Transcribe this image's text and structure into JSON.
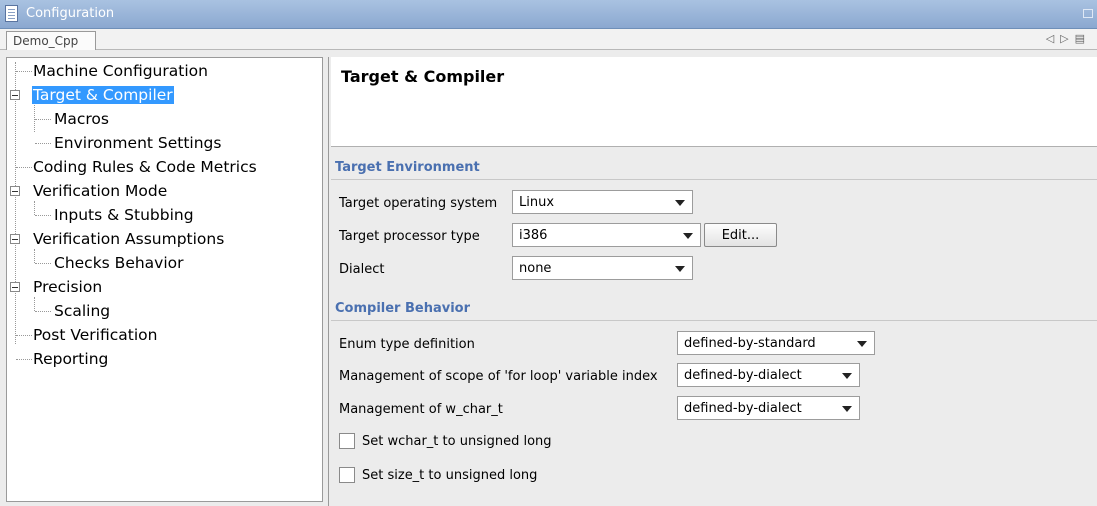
{
  "window": {
    "title": "Configuration"
  },
  "tabs": [
    {
      "label": "Demo_Cpp"
    }
  ],
  "tree": {
    "items": [
      {
        "label": "Machine Configuration"
      },
      {
        "label": "Target & Compiler",
        "selected": true
      },
      {
        "label": "Macros"
      },
      {
        "label": "Environment Settings"
      },
      {
        "label": "Coding Rules & Code Metrics"
      },
      {
        "label": "Verification Mode"
      },
      {
        "label": "Inputs & Stubbing"
      },
      {
        "label": "Verification Assumptions"
      },
      {
        "label": "Checks Behavior"
      },
      {
        "label": "Precision"
      },
      {
        "label": "Scaling"
      },
      {
        "label": "Post Verification"
      },
      {
        "label": "Reporting"
      }
    ]
  },
  "main": {
    "title": "Target & Compiler",
    "target_environment": {
      "heading": "Target Environment",
      "os_label": "Target operating system",
      "os_value": "Linux",
      "processor_label": "Target processor type",
      "processor_value": "i386",
      "edit_label": "Edit...",
      "dialect_label": "Dialect",
      "dialect_value": "none"
    },
    "compiler_behavior": {
      "heading": "Compiler Behavior",
      "enum_label": "Enum type definition",
      "enum_value": "defined-by-standard",
      "loop_label": "Management of scope of 'for loop' variable index",
      "loop_value": "defined-by-dialect",
      "wchar_label": "Management of w_char_t",
      "wchar_value": "defined-by-dialect",
      "wchar_unsigned_label": "Set wchar_t to unsigned long",
      "wchar_unsigned_checked": false,
      "size_unsigned_label": "Set size_t to unsigned long",
      "size_unsigned_checked": false
    }
  },
  "colors": {
    "accent": "#3399ff",
    "section_heading": "#4a70b0",
    "titlebar": "#8ba8d0"
  }
}
